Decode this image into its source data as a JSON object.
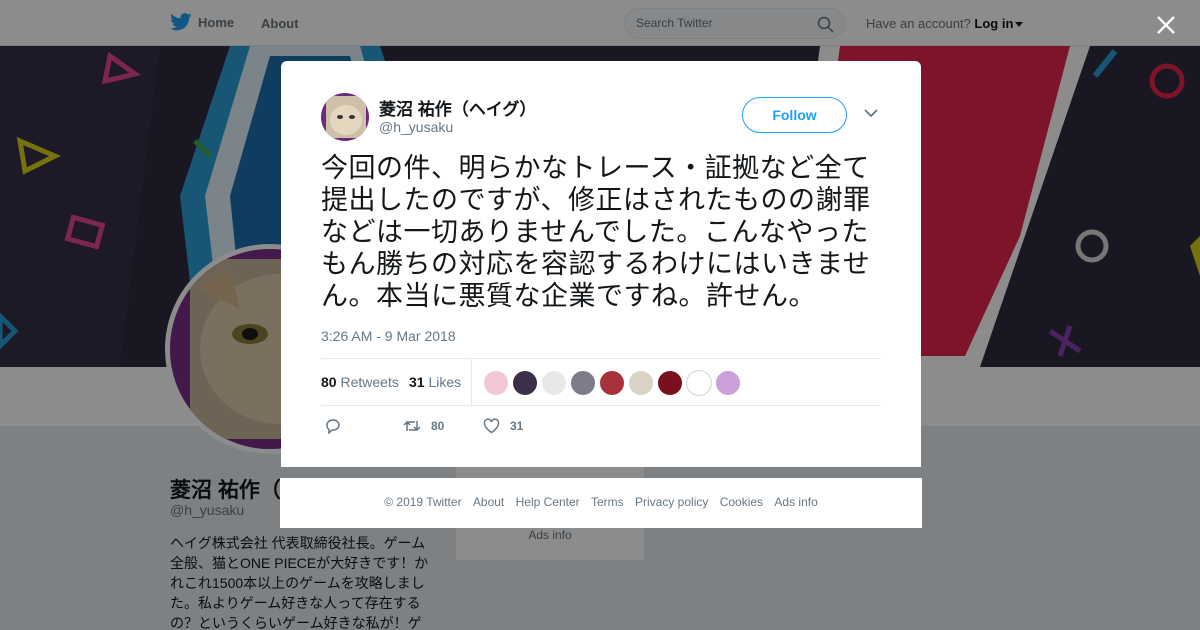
{
  "nav": {
    "home_label": "Home",
    "about_label": "About",
    "search_placeholder": "Search Twitter",
    "have_account": "Have an account?",
    "login_label": "Log in"
  },
  "profile": {
    "name": "菱沼 祐作（ヘイグ）",
    "handle": "@h_yusaku",
    "bio": "ヘイグ株式会社 代表取締役社長。ゲーム全般、猫とONE PIECEが大好きです！かれこれ1500本以上のゲームを攻略しました。私よりゲーム好きな人って存在するの？というくらいゲーム好きな私が！ゲ",
    "side_ads": "Ads info"
  },
  "tweet": {
    "author_name": "菱沼 祐作（ヘイグ）",
    "author_handle": "@h_yusaku",
    "follow_label": "Follow",
    "text": "今回の件、明らかなトレース・証拠など全て提出したのですが、修正はされたものの謝罪などは一切ありませんでした。こんなやったもん勝ちの対応を容認するわけにはいきません。本当に悪質な企業ですね。許せん。",
    "timestamp": "3:26 AM - 9 Mar 2018",
    "retweets_count": "80",
    "retweets_label": "Retweets",
    "likes_count": "31",
    "likes_label": "Likes",
    "retweet_action_count": "80",
    "like_action_count": "31",
    "liker_colors": [
      "#f3c6d8",
      "#3b2f4a",
      "#e8e8e8",
      "#7d7d8a",
      "#a8323a",
      "#d9d2c5",
      "#7a0f1e",
      "#ffffff",
      "#c9a0d8"
    ]
  },
  "footer": {
    "copyright": "© 2019 Twitter",
    "about": "About",
    "help": "Help Center",
    "terms": "Terms",
    "privacy": "Privacy policy",
    "cookies": "Cookies",
    "ads": "Ads info"
  },
  "colors": {
    "brand": "#1da1f2",
    "text_secondary": "#657786"
  }
}
